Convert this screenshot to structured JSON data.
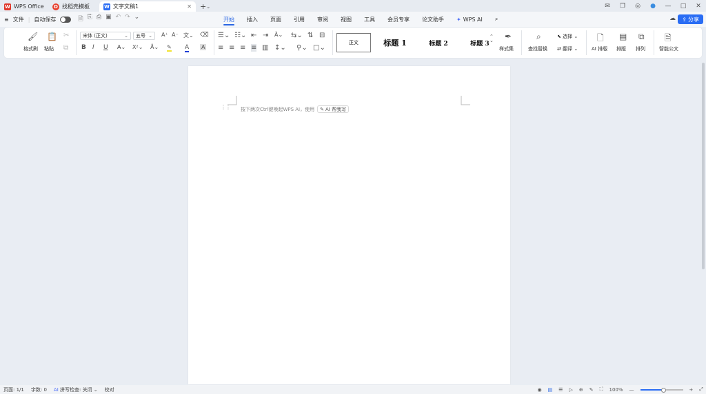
{
  "tabs": [
    {
      "label": "WPS Office",
      "icon": "wps-logo-icon",
      "color": "#e0382b"
    },
    {
      "label": "找稻壳模板",
      "icon": "docer-icon",
      "color": "#e8412f"
    },
    {
      "label": "文字文稿1",
      "icon": "writer-doc-icon",
      "color": "#2a6df4"
    }
  ],
  "menu": {
    "file": "文件",
    "autosave": "自动保存",
    "ribbon_tabs": [
      "开始",
      "插入",
      "页面",
      "引用",
      "审阅",
      "视图",
      "工具",
      "会员专享",
      "论文助手",
      "WPS AI"
    ],
    "active_tab": "开始",
    "share": "分享"
  },
  "ribbon": {
    "format_painter": "格式刷",
    "paste": "粘贴",
    "font_name": "宋体 (正文)",
    "font_size": "五号",
    "styles": [
      "正文",
      "标题 1",
      "标题 2",
      "标题 3"
    ],
    "style_set": "样式集",
    "find_replace": "查找替换",
    "select": "选择",
    "translate": "翻译",
    "ai_layout": "AI 排版",
    "layout": "排版",
    "arrange": "排列",
    "smart_doc": "智能公文",
    "bold": "B",
    "italic": "I",
    "underline": "U",
    "font_color_letter": "A"
  },
  "document": {
    "hint": "按下两次Ctrl键唤起WPS AI，使用",
    "ai_button": "AI 帮我写"
  },
  "status": {
    "page": "页面: 1/1",
    "words": "字数: 0",
    "spell": "拼写检查: 关闭",
    "proof": "校对",
    "zoom": "100%"
  },
  "colors": {
    "accent": "#2a66e3",
    "share_bg": "#2a6df4"
  }
}
